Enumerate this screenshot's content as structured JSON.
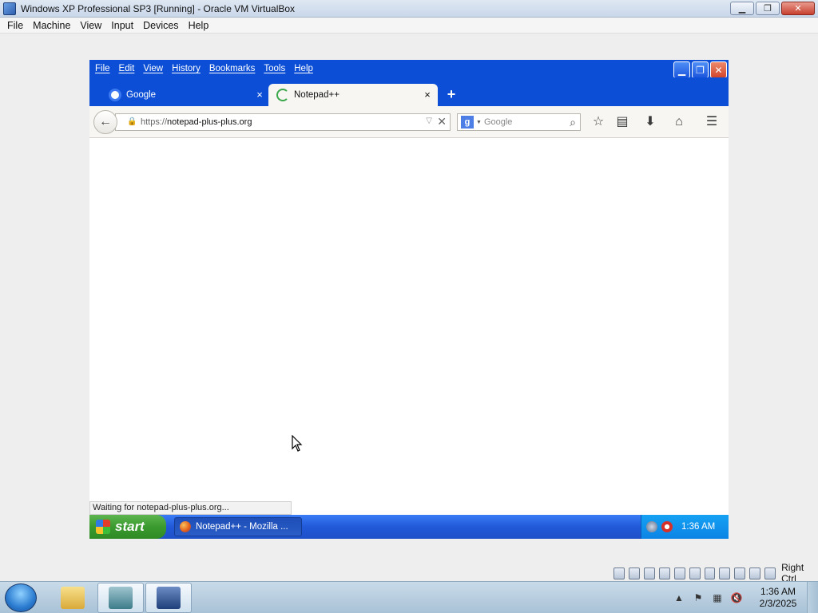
{
  "host": {
    "window_title": "Windows XP Professional SP3 [Running] - Oracle VM VirtualBox",
    "menu": [
      "File",
      "Machine",
      "View",
      "Input",
      "Devices",
      "Help"
    ],
    "host_key_label": "Right Ctrl"
  },
  "firefox": {
    "menu": [
      "File",
      "Edit",
      "View",
      "History",
      "Bookmarks",
      "Tools",
      "Help"
    ],
    "tabs": [
      {
        "label": "Google",
        "close": "×"
      },
      {
        "label": "Notepad++",
        "close": "×"
      }
    ],
    "new_tab": "+",
    "url": {
      "protocol": "https://",
      "host": "notepad-plus-plus.org"
    },
    "search": {
      "engine_badge": "g",
      "placeholder": "Google"
    },
    "status_text": "Waiting for notepad-plus-plus.org..."
  },
  "xp": {
    "start_label": "start",
    "task_label": "Notepad++ - Mozilla ...",
    "clock": "1:36 AM"
  },
  "win7": {
    "clock_time": "1:36 AM",
    "clock_date": "2/3/2025"
  },
  "colors": {
    "xp_blue": "#0c4fd6",
    "xp_start_green": "#3a9a2f",
    "firefox_toolbar": "#f7f6f3"
  }
}
